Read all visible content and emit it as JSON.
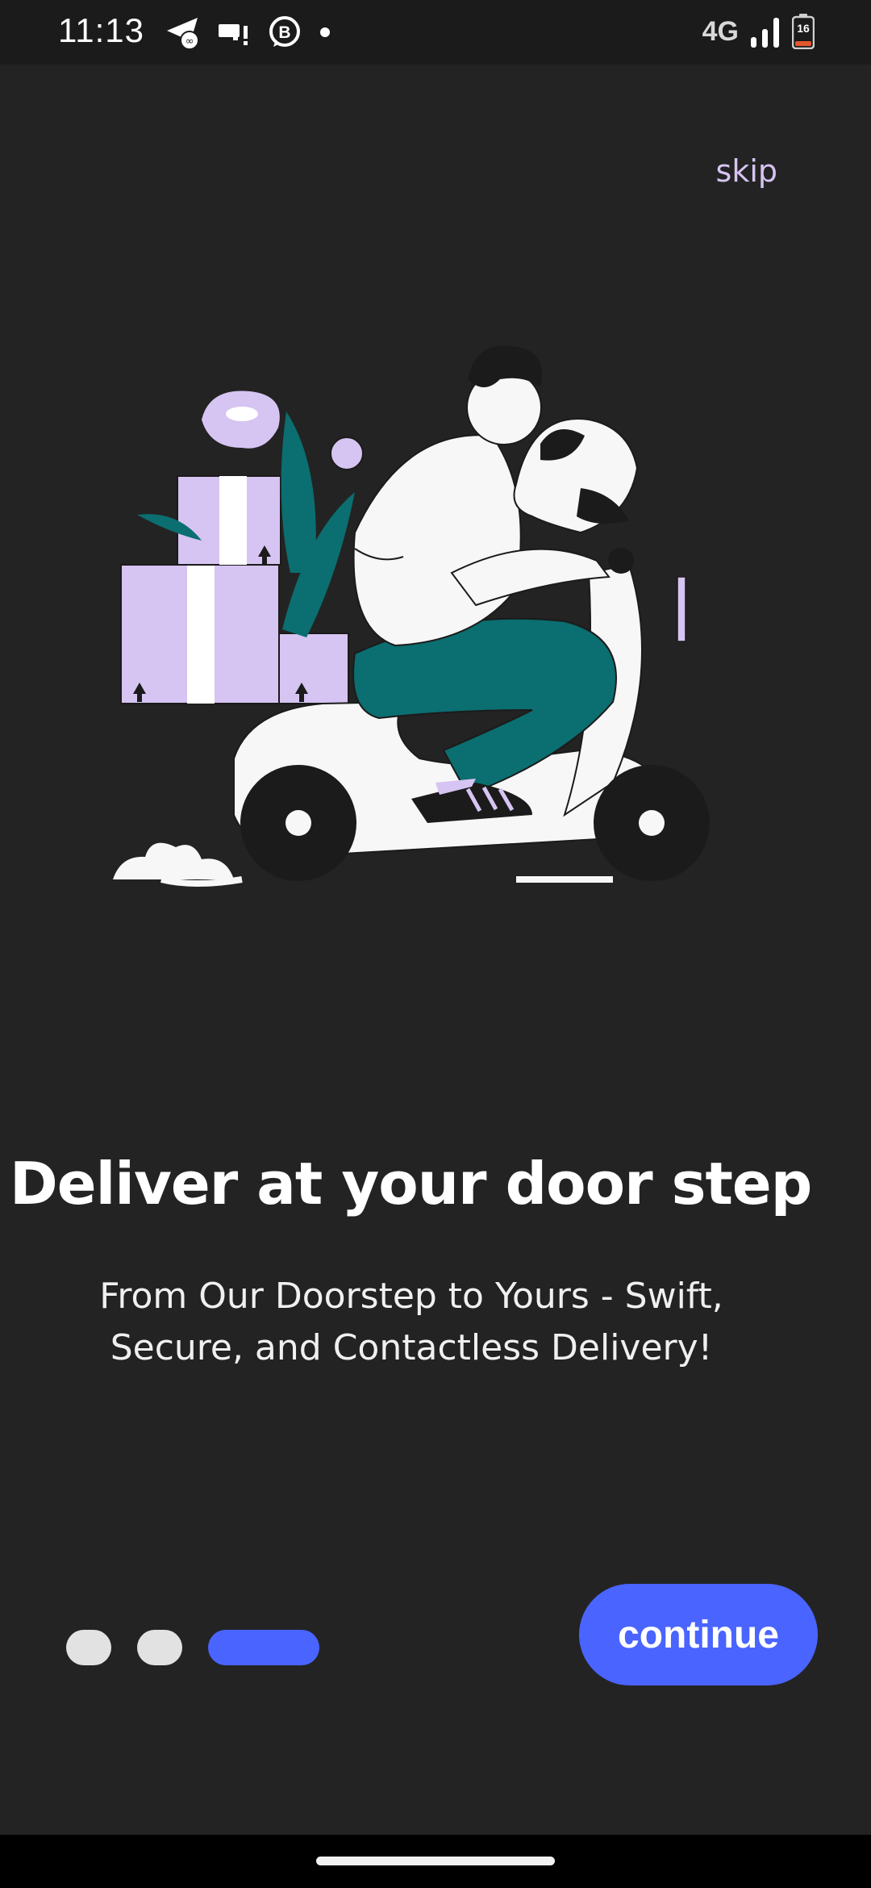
{
  "status_bar": {
    "time": "11:13",
    "network": "4G",
    "battery": "16",
    "left_icons": [
      "telegram-icon",
      "cast-alert-icon",
      "whatsapp-business-icon",
      "notification-dot-icon"
    ],
    "right_icons": [
      "signal-icon",
      "battery-icon"
    ]
  },
  "onboarding": {
    "skip_label": "skip",
    "illustration": "delivery-scooter-illustration",
    "title": "Deliver at your door step",
    "subtitle": "From Our Doorstep to Yours - Swift, Secure, and Contactless Delivery!",
    "pager": {
      "total": 3,
      "current": 3
    },
    "continue_label": "continue"
  },
  "colors": {
    "background": "#232323",
    "accent": "#4a64ff",
    "skip": "#d6c4f2",
    "illustration_purple": "#d6c4f2",
    "illustration_teal": "#0b6e70",
    "dot_inactive": "#e2e2e2"
  }
}
